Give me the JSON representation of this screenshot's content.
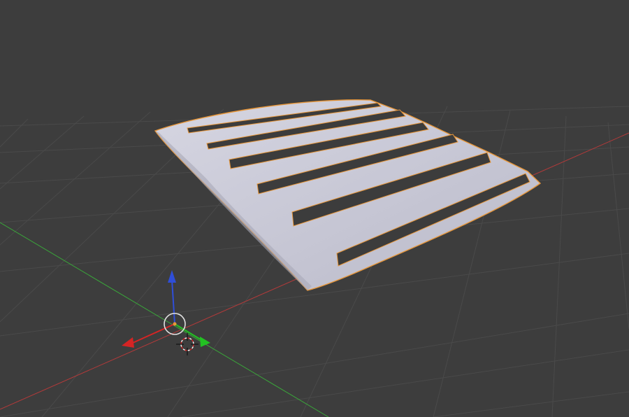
{
  "app": {
    "mode": "object-mode",
    "view": "perspective"
  },
  "colors": {
    "background": "#3d3d3d",
    "grid_line": "#4a4a4a",
    "axis_x": "#b33a3a",
    "axis_y": "#3aa53a",
    "mesh_fill": "#c8c8d6",
    "mesh_shade": "#a9a9b8",
    "selection_outline": "#e8973a",
    "slot_dark": "#3c3c3c",
    "gizmo_z": "#2f4ed8",
    "gizmo_x": "#d62424",
    "gizmo_y": "#22c122",
    "cursor_ring": "#e0e0e0"
  },
  "scene": {
    "selected_object": "louver-panel",
    "slot_count": 6,
    "icons": [
      "transform-gizmo-icon",
      "object-origin-icon",
      "3d-cursor-icon"
    ]
  }
}
